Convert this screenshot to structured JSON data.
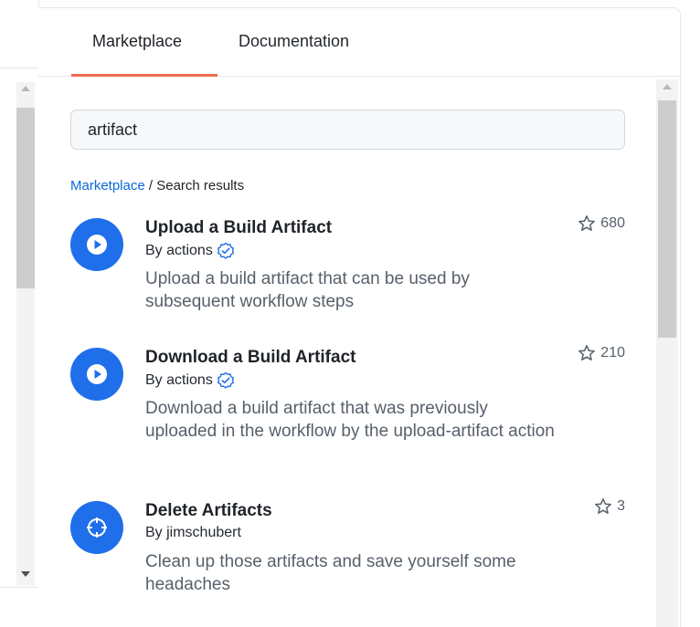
{
  "tabs": {
    "marketplace": "Marketplace",
    "documentation": "Documentation"
  },
  "search": {
    "value": "artifact"
  },
  "breadcrumb": {
    "link": "Marketplace",
    "separator": " / ",
    "current": "Search results"
  },
  "results": [
    {
      "title": "Upload a Build Artifact",
      "by": "By actions",
      "verified": true,
      "description": "Upload a build artifact that can be used by subsequent workflow steps",
      "stars": "680",
      "icon": "play-icon"
    },
    {
      "title": "Download a Build Artifact",
      "by": "By actions",
      "verified": true,
      "description": "Download a build artifact that was previously uploaded in the workflow by the upload-artifact action",
      "stars": "210",
      "icon": "play-icon"
    },
    {
      "title": "Delete Artifacts",
      "by": "By jimschubert",
      "verified": false,
      "description": "Clean up those artifacts and save yourself some headaches",
      "stars": "3",
      "icon": "crosshair-icon"
    }
  ],
  "colors": {
    "accent": "#1f6feb",
    "link": "#0969da",
    "tab_underline": "#f26b4f"
  }
}
